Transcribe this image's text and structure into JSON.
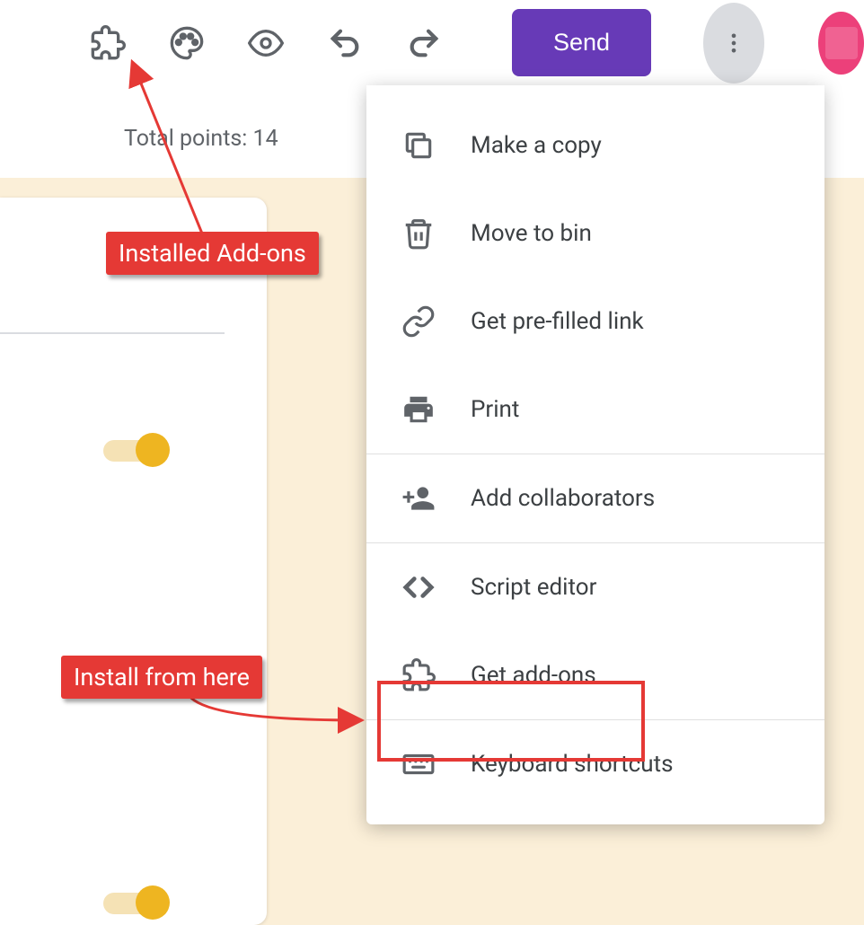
{
  "toolbar": {
    "send_label": "Send"
  },
  "subheader": {
    "text": "Total points: 14"
  },
  "menu": {
    "items": [
      {
        "label": "Make a copy"
      },
      {
        "label": "Move to bin"
      },
      {
        "label": "Get pre-filled link"
      },
      {
        "label": "Print"
      },
      {
        "label": "Add collaborators"
      },
      {
        "label": "Script editor"
      },
      {
        "label": "Get add-ons"
      },
      {
        "label": "Keyboard shortcuts"
      }
    ]
  },
  "annotations": {
    "installed": "Installed Add-ons",
    "install_here": "Install from here"
  }
}
